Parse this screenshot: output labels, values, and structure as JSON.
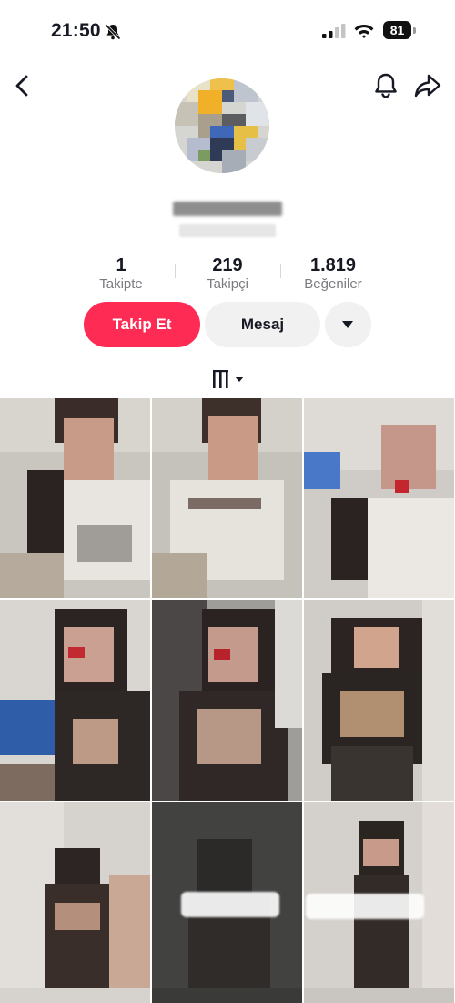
{
  "status_bar": {
    "time": "21:50",
    "battery": "81",
    "icons": [
      "bell-slash-icon",
      "cellular-signal-icon",
      "wifi-icon",
      "battery-icon"
    ]
  },
  "nav": {
    "icons": [
      "back-arrow-icon",
      "notification-bell-icon",
      "share-arrow-icon"
    ]
  },
  "profile": {
    "name": "",
    "handle": ""
  },
  "stats": [
    {
      "value": "1",
      "label": "Takipte"
    },
    {
      "value": "219",
      "label": "Takipçi"
    },
    {
      "value": "1.819",
      "label": "Beğeniler"
    }
  ],
  "actions": {
    "follow_label": "Takip Et",
    "message_label": "Mesaj"
  },
  "colors": {
    "accent": "#fe2c55",
    "secondary_button": "#f1f1f2",
    "muted_text": "#7a7b80"
  },
  "grid": {
    "toggle_icon": "grid-view-icon",
    "videos": [
      {
        "kind": "video-thumbnail"
      },
      {
        "kind": "video-thumbnail"
      },
      {
        "kind": "video-thumbnail"
      },
      {
        "kind": "video-thumbnail"
      },
      {
        "kind": "video-thumbnail"
      },
      {
        "kind": "video-thumbnail"
      },
      {
        "kind": "video-thumbnail"
      },
      {
        "kind": "video-thumbnail"
      },
      {
        "kind": "video-thumbnail"
      }
    ]
  }
}
